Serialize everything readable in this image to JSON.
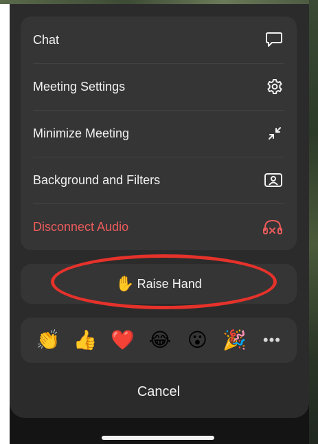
{
  "menu": {
    "items": [
      {
        "label": "Chat",
        "icon": "chat-bubble-icon"
      },
      {
        "label": "Meeting Settings",
        "icon": "gear-icon"
      },
      {
        "label": "Minimize Meeting",
        "icon": "minimize-arrows-icon"
      },
      {
        "label": "Background and Filters",
        "icon": "person-frame-icon"
      },
      {
        "label": "Disconnect Audio",
        "icon": "headphones-x-icon"
      }
    ]
  },
  "raise_hand": {
    "emoji": "✋",
    "label": "Raise Hand"
  },
  "reactions": {
    "items": [
      {
        "emoji": "👏",
        "name": "clapping-hands"
      },
      {
        "emoji": "👍",
        "name": "thumbs-up"
      },
      {
        "emoji": "❤️",
        "name": "heart"
      },
      {
        "emoji": "😂",
        "name": "tears-of-joy"
      },
      {
        "emoji": "😮",
        "name": "open-mouth"
      },
      {
        "emoji": "🎉",
        "name": "party-popper"
      }
    ],
    "more_label": "•••"
  },
  "cancel_label": "Cancel",
  "colors": {
    "sheet": "#2b2b2b",
    "card": "#353535",
    "text": "#f2f2f2",
    "danger": "#ec5b5b",
    "annotation": "#e5322b"
  }
}
